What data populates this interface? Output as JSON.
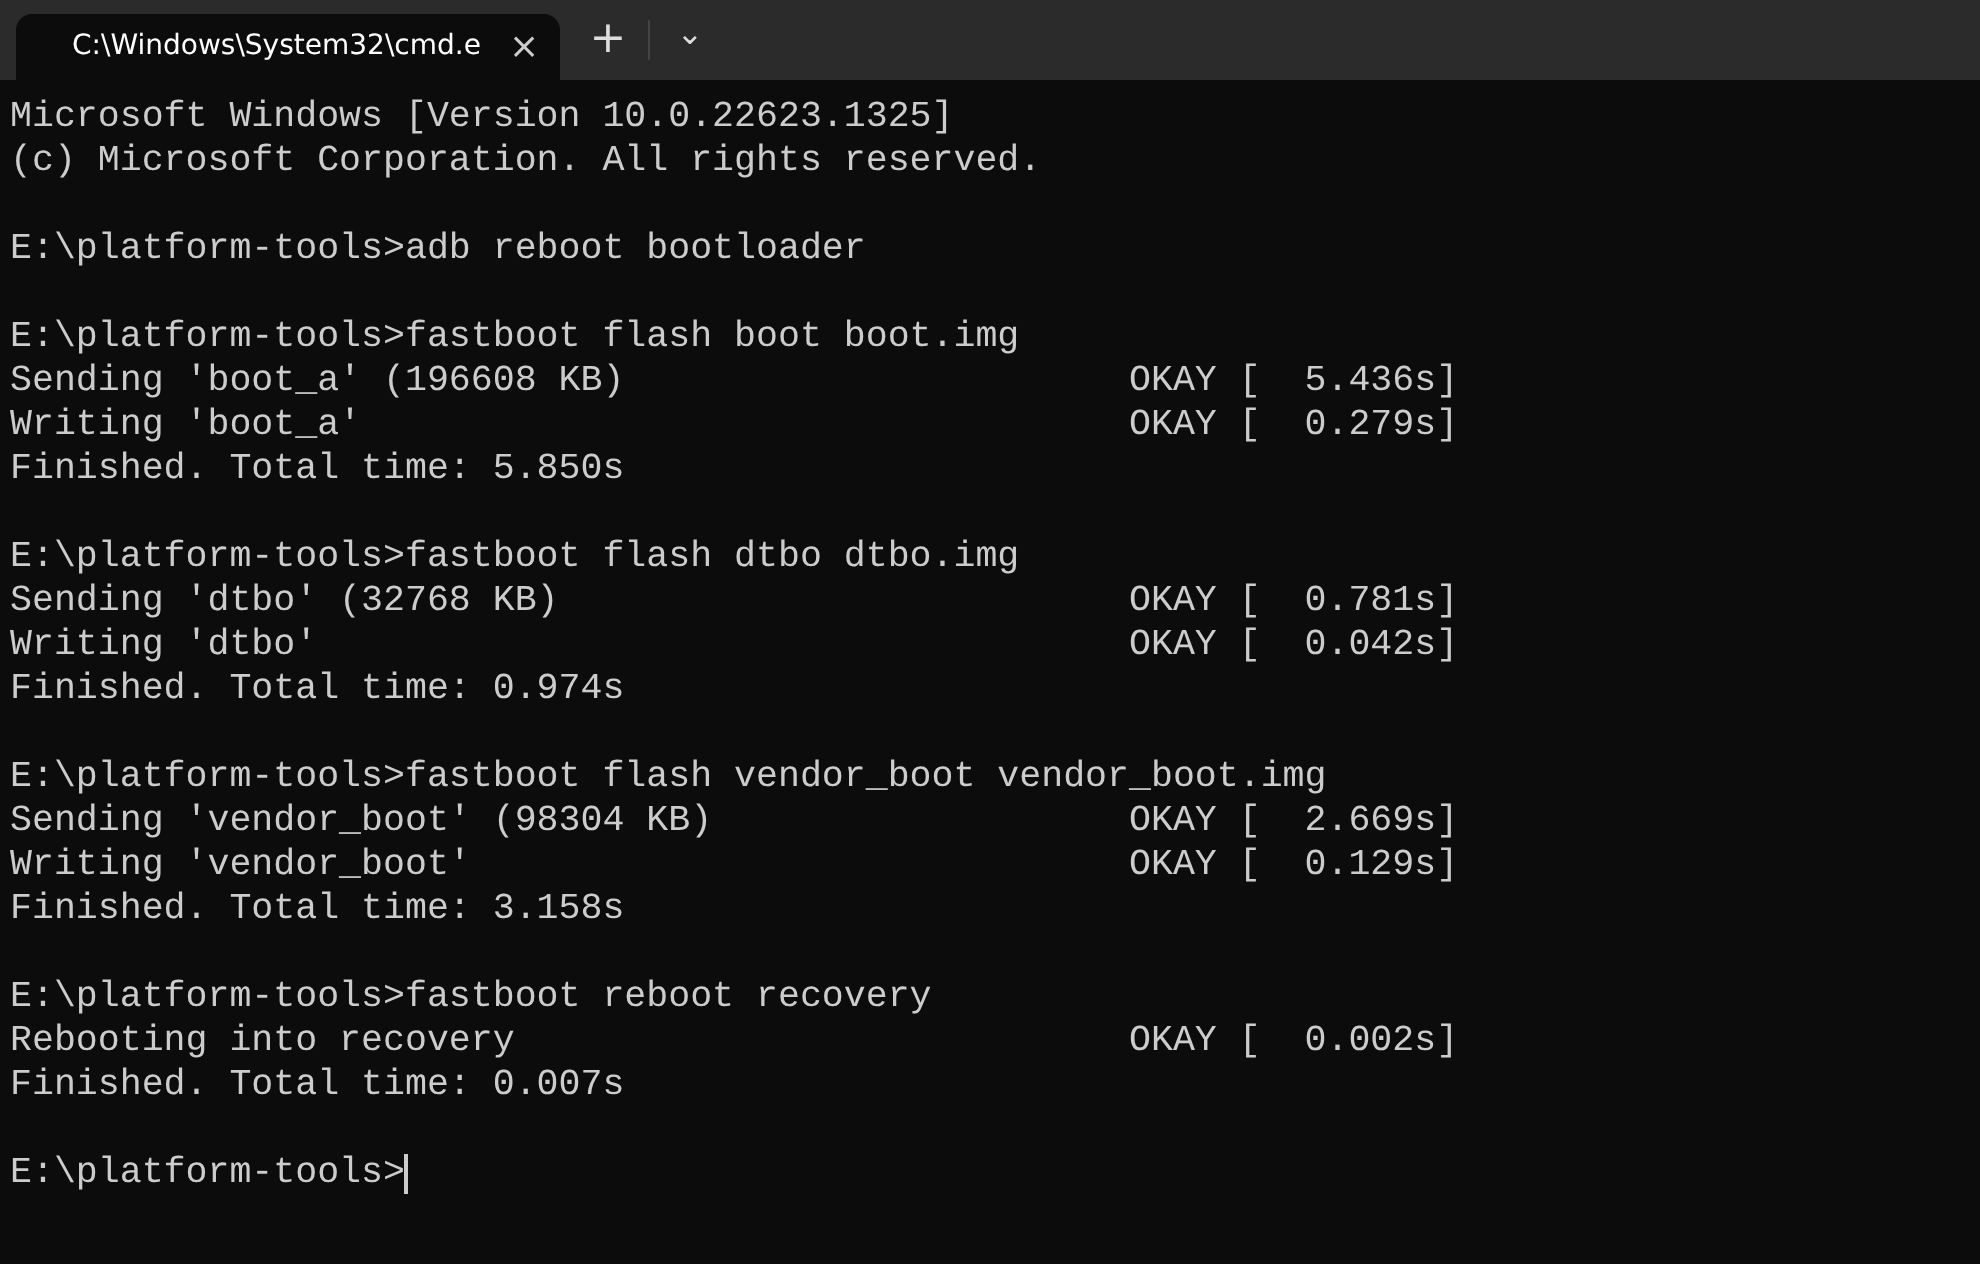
{
  "tab": {
    "title": "C:\\Windows\\System32\\cmd.e",
    "selected": true,
    "close": "×"
  },
  "tab_bar_buttons": {
    "new_tab": "+",
    "dropdown": "⌄"
  },
  "terminal": {
    "blocks": [
      [
        "Microsoft Windows [Version 10.0.22623.1325]",
        "(c) Microsoft Corporation. All rights reserved."
      ],
      [
        "E:\\platform-tools>adb reboot bootloader"
      ],
      [
        "E:\\platform-tools>fastboot flash boot boot.img",
        "Sending 'boot_a' (196608 KB)                       OKAY [  5.436s]",
        "Writing 'boot_a'                                   OKAY [  0.279s]",
        "Finished. Total time: 5.850s"
      ],
      [
        "E:\\platform-tools>fastboot flash dtbo dtbo.img",
        "Sending 'dtbo' (32768 KB)                          OKAY [  0.781s]",
        "Writing 'dtbo'                                     OKAY [  0.042s]",
        "Finished. Total time: 0.974s"
      ],
      [
        "E:\\platform-tools>fastboot flash vendor_boot vendor_boot.img",
        "Sending 'vendor_boot' (98304 KB)                   OKAY [  2.669s]",
        "Writing 'vendor_boot'                              OKAY [  0.129s]",
        "Finished. Total time: 3.158s"
      ],
      [
        "E:\\platform-tools>fastboot reboot recovery",
        "Rebooting into recovery                            OKAY [  0.002s]",
        "Finished. Total time: 0.007s"
      ],
      [
        "E:\\platform-tools>"
      ]
    ]
  }
}
